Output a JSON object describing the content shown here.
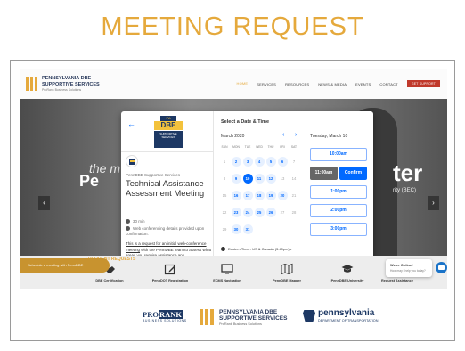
{
  "page_title": "MEETING REQUEST",
  "site": {
    "logo_line1": "PENNSYLVANIA DBE",
    "logo_line2": "SUPPORTIVE SERVICES",
    "logo_sub": "ProRank Business Solutions",
    "nav": [
      {
        "label": "HOME",
        "active": true
      },
      {
        "label": "SERVICES"
      },
      {
        "label": "RESOURCES"
      },
      {
        "label": "NEWS & MEDIA"
      },
      {
        "label": "EVENTS"
      },
      {
        "label": "CONTACT"
      },
      {
        "label": "GET SUPPORT"
      }
    ],
    "hero_bg_text": "the m",
    "hero_big_left": "Pe",
    "hero_big_right": "ter",
    "hero_small_right": "rity (BEC)"
  },
  "scheduler": {
    "badge_top": "PA",
    "badge_main": "DBE",
    "badge_sub": "SUPPORTIVE SERVICES",
    "org_name": "PennDBE Supportive Services",
    "event_title": "Technical Assistance Assessment Meeting",
    "duration": "30 min",
    "conferencing": "Web conferencing details provided upon confirmation.",
    "description_underlined": "This is a request for an initial web-conference meeting",
    "description_rest": " with the PennDBE team to assess what areas you require assistance and",
    "heading": "Select a Date & Time",
    "month": "March 2020",
    "weekdays": [
      "SUN",
      "MON",
      "TUE",
      "WED",
      "THU",
      "FRI",
      "SAT"
    ],
    "days": [
      {
        "n": "1",
        "s": "d"
      },
      {
        "n": "2",
        "s": "a"
      },
      {
        "n": "3",
        "s": "a"
      },
      {
        "n": "4",
        "s": "a"
      },
      {
        "n": "5",
        "s": "a"
      },
      {
        "n": "6",
        "s": "a"
      },
      {
        "n": "7",
        "s": "d"
      },
      {
        "n": "8",
        "s": "d"
      },
      {
        "n": "9",
        "s": "a"
      },
      {
        "n": "10",
        "s": "s"
      },
      {
        "n": "11",
        "s": "a"
      },
      {
        "n": "12",
        "s": "a"
      },
      {
        "n": "13",
        "s": "d"
      },
      {
        "n": "14",
        "s": "d"
      },
      {
        "n": "15",
        "s": "d"
      },
      {
        "n": "16",
        "s": "a"
      },
      {
        "n": "17",
        "s": "a"
      },
      {
        "n": "18",
        "s": "a"
      },
      {
        "n": "19",
        "s": "a"
      },
      {
        "n": "20",
        "s": "a"
      },
      {
        "n": "21",
        "s": "d"
      },
      {
        "n": "22",
        "s": "d"
      },
      {
        "n": "23",
        "s": "a"
      },
      {
        "n": "24",
        "s": "a"
      },
      {
        "n": "25",
        "s": "a"
      },
      {
        "n": "26",
        "s": "a"
      },
      {
        "n": "27",
        "s": "d"
      },
      {
        "n": "28",
        "s": "d"
      },
      {
        "n": "29",
        "s": "d"
      },
      {
        "n": "30",
        "s": "a"
      },
      {
        "n": "31",
        "s": "a"
      }
    ],
    "timezone": "Eastern Time - US & Canada (3:40pm) ▾",
    "selected_date": "Tuesday, March 10",
    "slots": [
      "10:00am",
      "1:00pm",
      "2:00pm",
      "3:00pm"
    ],
    "selected_slot": "11:00am",
    "confirm_label": "Confirm"
  },
  "services": {
    "heading": "FREQUENT REQUESTS",
    "items": [
      {
        "label": "DBE Certification",
        "icon": "handshake-icon"
      },
      {
        "label": "PennDOT Registration",
        "icon": "edit-icon"
      },
      {
        "label": "ECMS Navigation",
        "icon": "monitor-icon"
      },
      {
        "label": "PennDBE Mapper",
        "icon": "map-icon"
      },
      {
        "label": "PennDBE University",
        "icon": "graduation-cap-icon"
      },
      {
        "label": "Request Assistance",
        "icon": "question-icon"
      }
    ]
  },
  "cta_label": "Schedule a meeting with PennDBE",
  "chat": {
    "title": "We're Online!",
    "subtitle": "How may I help you today?"
  },
  "footer": {
    "prorank_pro": "PRO",
    "prorank_rank": "RANK",
    "prorank_sub": "BUSINESS SOLUTIONS",
    "pdbe_line1": "PENNSYLVANIA DBE",
    "pdbe_line2": "SUPPORTIVE SERVICES",
    "pdbe_sub": "ProRank Business Solutions",
    "penn_name": "pennsylvania",
    "penn_dept": "DEPARTMENT OF TRANSPORTATION"
  },
  "colors": {
    "title_gold": "#e5a93c",
    "calendly_blue": "#0069ff",
    "navy": "#1d3864"
  }
}
